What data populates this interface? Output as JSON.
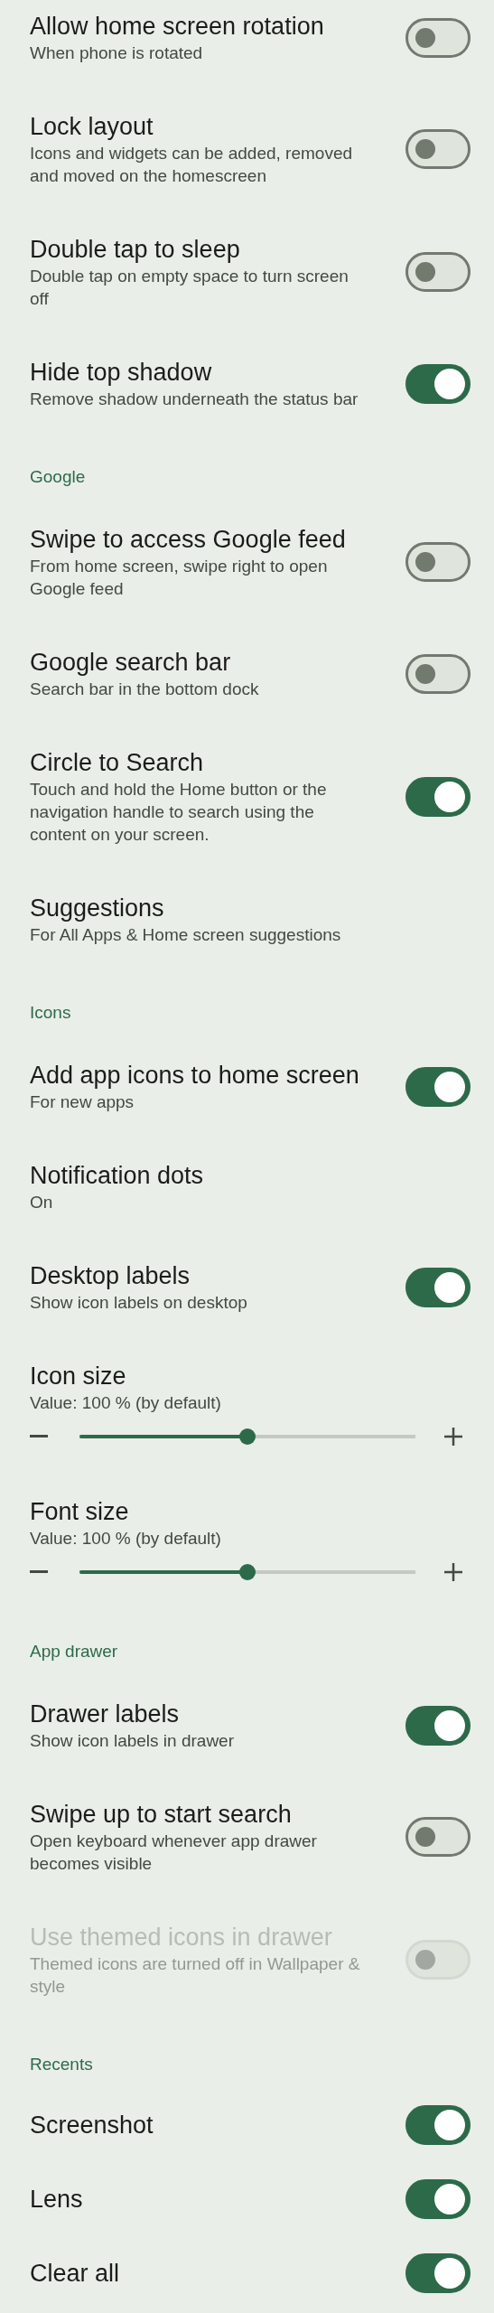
{
  "sections": [
    {
      "items": [
        {
          "kind": "toggle",
          "title": "Allow home screen rotation",
          "summary": "When phone is rotated",
          "on": false,
          "disabled": false
        },
        {
          "kind": "toggle",
          "title": "Lock layout",
          "summary": "Icons and widgets can be added, removed and moved on the homescreen",
          "on": false,
          "disabled": false
        },
        {
          "kind": "toggle",
          "title": "Double tap to sleep",
          "summary": "Double tap on empty space to turn screen off",
          "on": false,
          "disabled": false
        },
        {
          "kind": "toggle",
          "title": "Hide top shadow",
          "summary": "Remove shadow underneath the status bar",
          "on": true,
          "disabled": false
        }
      ]
    },
    {
      "header": "Google",
      "items": [
        {
          "kind": "toggle",
          "title": "Swipe to access Google feed",
          "summary": "From home screen, swipe right to open Google feed",
          "on": false,
          "disabled": false
        },
        {
          "kind": "toggle",
          "title": "Google search bar",
          "summary": "Search bar in the bottom dock",
          "on": false,
          "disabled": false
        },
        {
          "kind": "toggle",
          "title": "Circle to Search",
          "summary": "Touch and hold the Home button or the navigation handle to search using the content on your screen.",
          "on": true,
          "disabled": false
        },
        {
          "kind": "plain",
          "title": "Suggestions",
          "summary": "For All Apps & Home screen suggestions"
        }
      ]
    },
    {
      "header": "Icons",
      "items": [
        {
          "kind": "toggle",
          "title": "Add app icons to home screen",
          "summary": "For new apps",
          "on": true,
          "disabled": false
        },
        {
          "kind": "plain",
          "title": "Notification dots",
          "summary": "On"
        },
        {
          "kind": "toggle",
          "title": "Desktop labels",
          "summary": "Show icon labels on desktop",
          "on": true,
          "disabled": false
        },
        {
          "kind": "slider",
          "title": "Icon size",
          "summary": "Value: 100 % (by default)",
          "level": 0.5
        },
        {
          "kind": "slider",
          "title": "Font size",
          "summary": "Value: 100 % (by default)",
          "level": 0.5
        }
      ]
    },
    {
      "header": "App drawer",
      "items": [
        {
          "kind": "toggle",
          "title": "Drawer labels",
          "summary": "Show icon labels in drawer",
          "on": true,
          "disabled": false
        },
        {
          "kind": "toggle",
          "title": "Swipe up to start search",
          "summary": "Open keyboard whenever app drawer becomes visible",
          "on": false,
          "disabled": false
        },
        {
          "kind": "toggle",
          "title": "Use themed icons in drawer",
          "summary": "Themed icons are turned off in Wallpaper & style",
          "on": false,
          "disabled": true
        }
      ]
    },
    {
      "header": "Recents",
      "items": [
        {
          "kind": "toggle",
          "title": "Screenshot",
          "on": true,
          "disabled": false
        },
        {
          "kind": "toggle",
          "title": "Lens",
          "on": true,
          "disabled": false
        },
        {
          "kind": "toggle",
          "title": "Clear all",
          "on": true,
          "disabled": false
        }
      ]
    }
  ]
}
